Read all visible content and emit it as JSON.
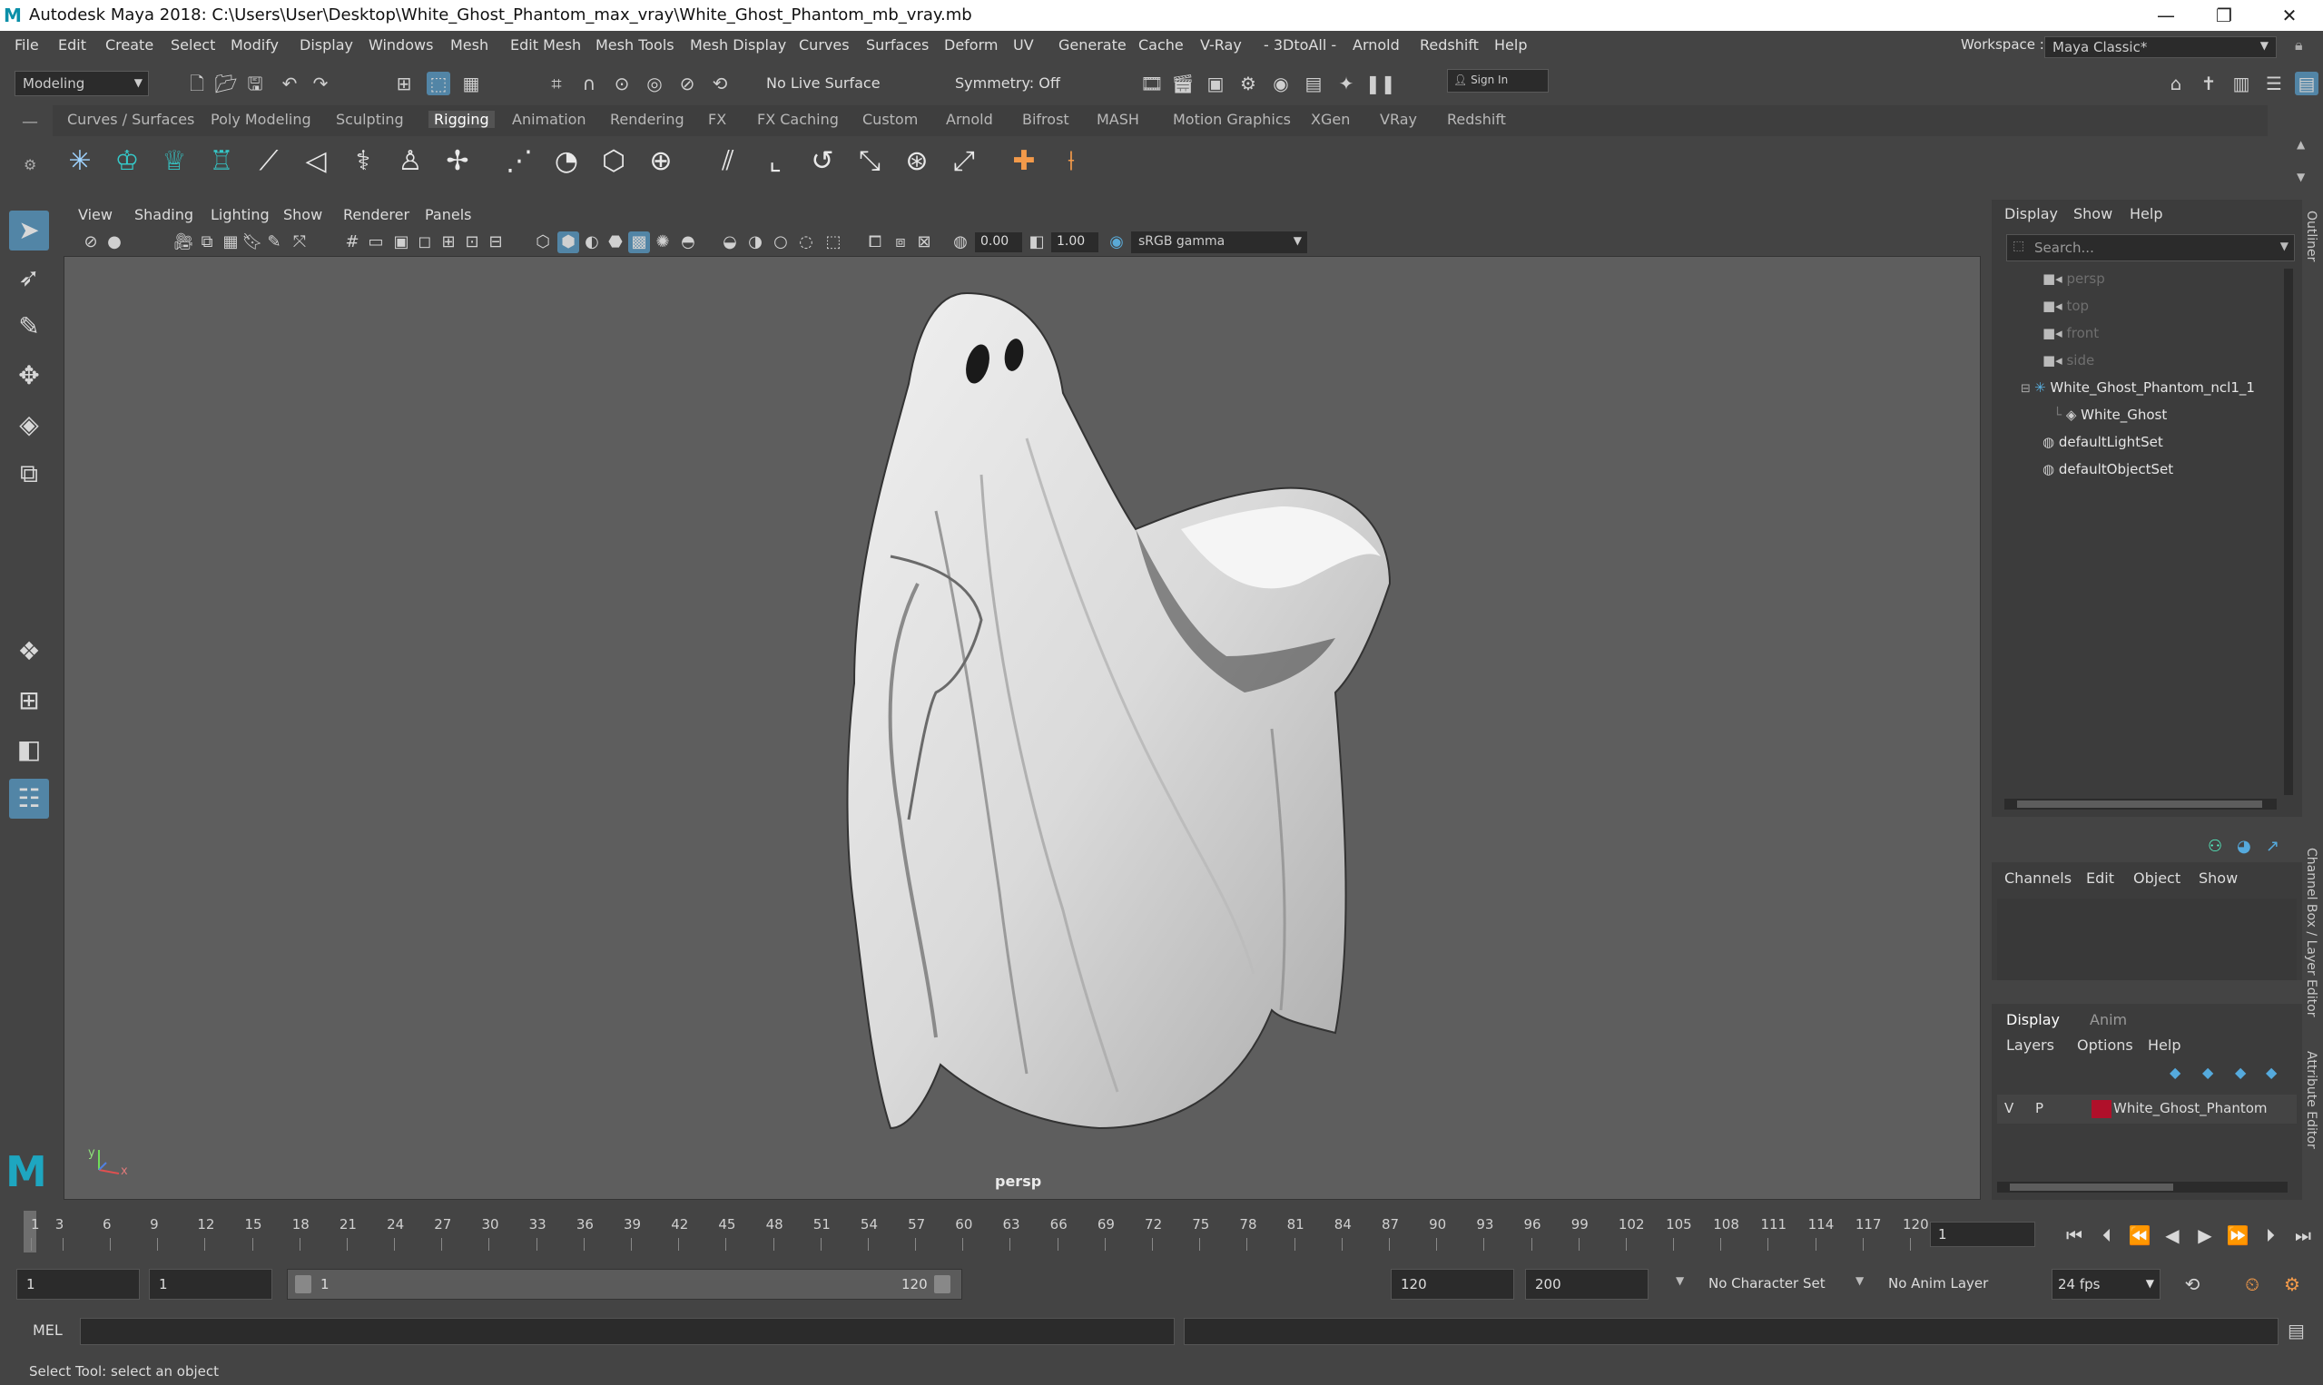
{
  "window": {
    "title": "Autodesk Maya 2018: C:\\Users\\User\\Desktop\\White_Ghost_Phantom_max_vray\\White_Ghost_Phantom_mb_vray.mb",
    "logo": "M",
    "minimize": "—",
    "restore": "❐",
    "close": "✕"
  },
  "menubar": {
    "items": [
      "File",
      "Edit",
      "Create",
      "Select",
      "Modify",
      "Display",
      "Windows",
      "Mesh",
      "Edit Mesh",
      "Mesh Tools",
      "Mesh Display",
      "Curves",
      "Surfaces",
      "Deform",
      "UV",
      "Generate",
      "Cache",
      "V-Ray",
      "- 3DtoAll -",
      "Arnold",
      "Redshift",
      "Help"
    ],
    "workspace_label": "Workspace :",
    "workspace_value": "Maya Classic*"
  },
  "statusline": {
    "mode": "Modeling",
    "live_surface": "No Live Surface",
    "symmetry": "Symmetry: Off",
    "sign_in": "Sign In"
  },
  "shelf": {
    "tabs": [
      "Curves / Surfaces",
      "Poly Modeling",
      "Sculpting",
      "Rigging",
      "Animation",
      "Rendering",
      "FX",
      "FX Caching",
      "Custom",
      "Arnold",
      "Bifrost",
      "MASH",
      "Motion Graphics",
      "XGen",
      "VRay",
      "Redshift"
    ],
    "active_tab": "Rigging"
  },
  "viewport": {
    "menus": [
      "View",
      "Shading",
      "Lighting",
      "Show",
      "Renderer",
      "Panels"
    ],
    "exposure": "0.00",
    "gamma": "1.00",
    "color_space": "sRGB gamma",
    "camera_label": "persp",
    "axis_y": "y",
    "axis_x": "x"
  },
  "outliner": {
    "menus": [
      "Display",
      "Show",
      "Help"
    ],
    "search_placeholder": "Search...",
    "items": [
      {
        "label": "persp",
        "icon": "camera-icon"
      },
      {
        "label": "top",
        "icon": "camera-icon"
      },
      {
        "label": "front",
        "icon": "camera-icon"
      },
      {
        "label": "side",
        "icon": "camera-icon"
      },
      {
        "label": "White_Ghost_Phantom_ncl1_1",
        "icon": "joint-icon"
      },
      {
        "label": "White_Ghost",
        "icon": "mesh-icon"
      },
      {
        "label": "defaultLightSet",
        "icon": "set-icon"
      },
      {
        "label": "defaultObjectSet",
        "icon": "set-icon"
      }
    ]
  },
  "channel_box": {
    "menus": [
      "Channels",
      "Edit",
      "Object",
      "Show"
    ]
  },
  "layer_editor": {
    "tabs": [
      "Display",
      "Anim"
    ],
    "menus": [
      "Layers",
      "Options",
      "Help"
    ],
    "layer": {
      "v": "V",
      "p": "P",
      "name": "White_Ghost_Phantom",
      "color": "#b0102a"
    }
  },
  "side_tabs": [
    "Outliner",
    "Channel Box / Layer Editor",
    "Attribute Editor"
  ],
  "timeline": {
    "ticks": [
      "1",
      "3",
      "6",
      "9",
      "12",
      "15",
      "18",
      "21",
      "24",
      "27",
      "30",
      "33",
      "36",
      "39",
      "42",
      "45",
      "48",
      "51",
      "54",
      "57",
      "60",
      "63",
      "66",
      "69",
      "72",
      "75",
      "78",
      "81",
      "84",
      "87",
      "90",
      "93",
      "96",
      "99",
      "102",
      "105",
      "108",
      "111",
      "114",
      "117",
      "120"
    ],
    "current_frame": "1"
  },
  "range": {
    "start": "1",
    "inner_start": "1",
    "slider_start": "1",
    "slider_end": "120",
    "end": "120",
    "total_end": "200",
    "character_set": "No Character Set",
    "anim_layer": "No Anim Layer",
    "fps": "24 fps"
  },
  "mel": {
    "label": "MEL"
  },
  "help_line": "Select Tool: select an object"
}
